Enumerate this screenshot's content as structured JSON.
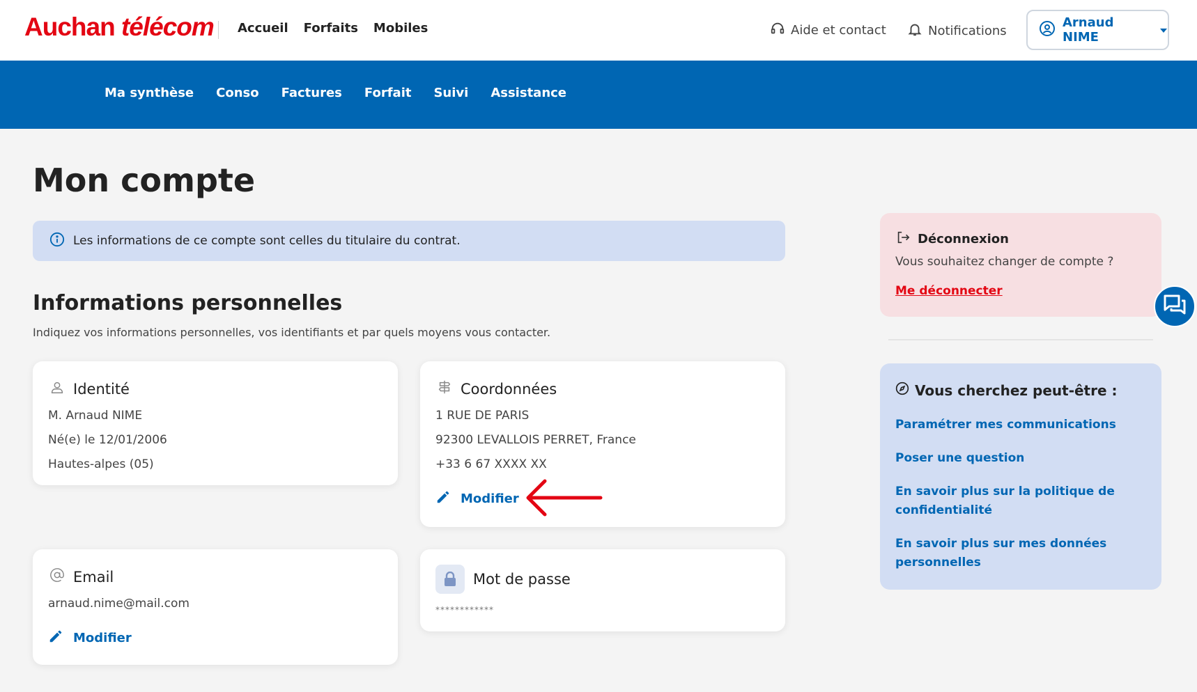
{
  "header": {
    "logo_brand": "Auchan",
    "logo_sub": "télécom",
    "nav": [
      "Accueil",
      "Forfaits",
      "Mobiles"
    ],
    "help_label": "Aide et contact",
    "notifications_label": "Notifications",
    "user_label": "Arnaud NIME"
  },
  "subnav": [
    "Ma synthèse",
    "Conso",
    "Factures",
    "Forfait",
    "Suivi",
    "Assistance"
  ],
  "page_title": "Mon compte",
  "info_banner": "Les informations de ce compte sont celles du titulaire du contrat.",
  "section": {
    "title": "Informations personnelles",
    "description": "Indiquez vos informations personnelles, vos identifiants et par quels moyens vous contacter."
  },
  "cards": {
    "identity": {
      "title": "Identité",
      "lines": [
        "M. Arnaud NIME",
        "Né(e) le 12/01/2006",
        "Hautes-alpes (05)"
      ]
    },
    "contact": {
      "title": "Coordonnées",
      "lines": [
        "1 RUE DE PARIS",
        "92300 LEVALLOIS PERRET, France",
        "+33 6 67 XXXX XX"
      ],
      "modify_label": "Modifier"
    },
    "email": {
      "title": "Email",
      "lines": [
        "arnaud.nime@mail.com"
      ],
      "modify_label": "Modifier"
    },
    "password": {
      "title": "Mot de passe",
      "masked": "************"
    }
  },
  "logout": {
    "title": "Déconnexion",
    "description": "Vous souhaitez changer de compte ?",
    "link": "Me déconnecter"
  },
  "suggestions": {
    "title": "Vous cherchez peut-être :",
    "links": [
      "Paramétrer mes communications",
      "Poser une question",
      "En savoir plus sur la politique de confidentialité",
      "En savoir plus sur mes données personnelles"
    ]
  },
  "colors": {
    "brand_red": "#e30613",
    "brand_blue": "#0066b3",
    "info_bg": "#d2ddf3",
    "logout_bg": "#f7dfe2"
  }
}
